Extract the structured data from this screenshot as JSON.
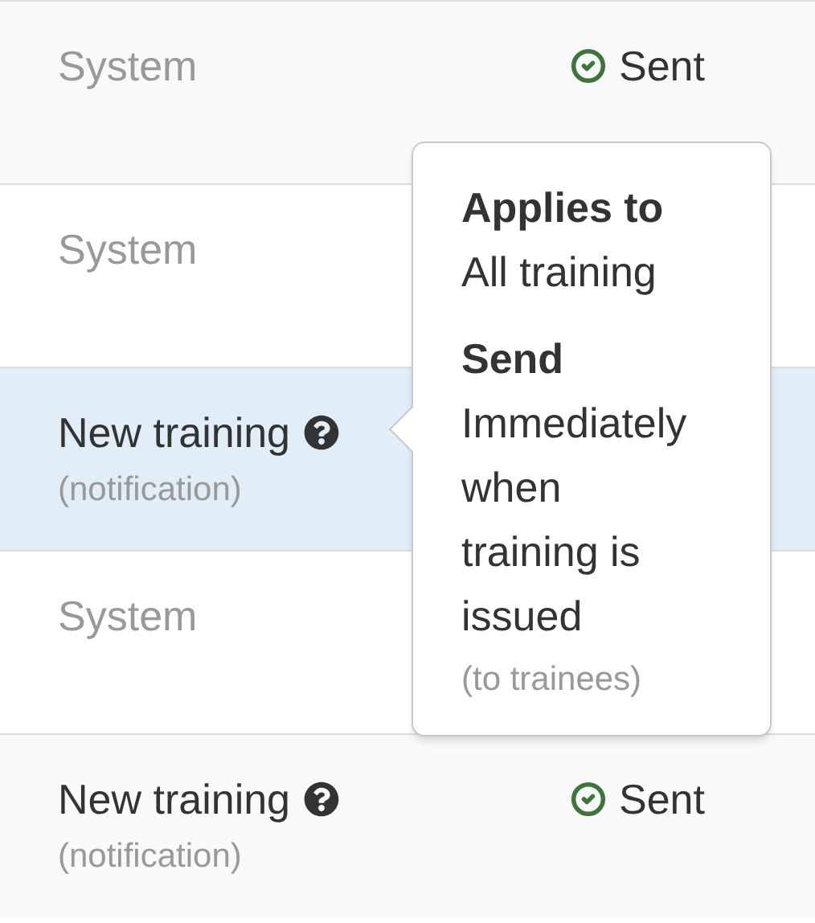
{
  "rows": [
    {
      "kind": "system",
      "label": "System",
      "selected": false,
      "status": "Sent"
    },
    {
      "kind": "system",
      "label": "System",
      "selected": false
    },
    {
      "kind": "notification",
      "label": "New training",
      "sublabel": "(notification)",
      "selected": true
    },
    {
      "kind": "system",
      "label": "System",
      "selected": false
    },
    {
      "kind": "notification",
      "label": "New training",
      "sublabel": "(notification)",
      "selected": false,
      "status": "Sent"
    }
  ],
  "tooltip": {
    "sections": [
      {
        "heading": "Applies to",
        "text": "All training"
      },
      {
        "heading": "Send",
        "text": "Immediately when training is issued",
        "note": "(to trainees)"
      }
    ]
  }
}
